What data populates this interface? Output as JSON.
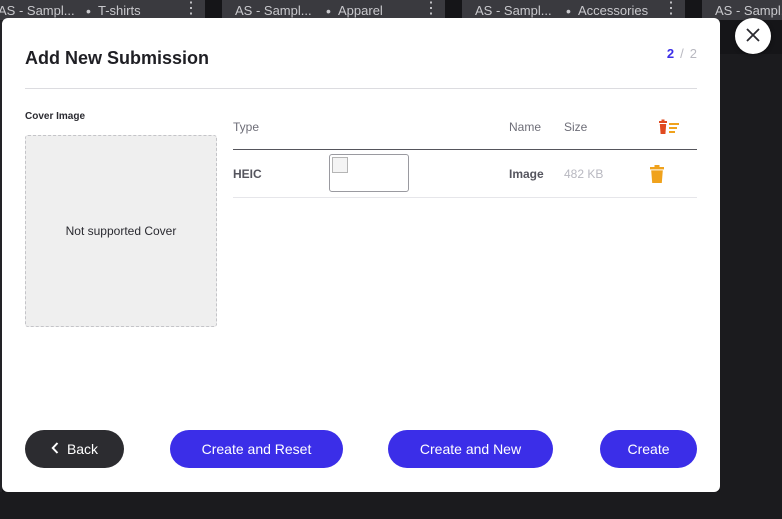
{
  "background_cards": [
    {
      "title": "AS - Sampl...",
      "category": "T-shirts"
    },
    {
      "title": "AS - Sampl...",
      "category": "Apparel"
    },
    {
      "title": "AS - Sampl...",
      "category": "Accessories"
    },
    {
      "title": "AS - Sampl...",
      "category": ""
    }
  ],
  "modal": {
    "title": "Add New Submission",
    "step_current": "2",
    "step_separator": "/",
    "step_total": "2"
  },
  "cover": {
    "label": "Cover Image",
    "placeholder_text": "Not supported Cover"
  },
  "table": {
    "headers": {
      "type": "Type",
      "name": "Name",
      "size": "Size"
    },
    "rows": [
      {
        "type": "HEIC",
        "name": "Image",
        "size": "482 KB"
      }
    ]
  },
  "buttons": {
    "back": "Back",
    "create_and_reset": "Create and Reset",
    "create_and_new": "Create and New",
    "create": "Create"
  },
  "colors": {
    "primary": "#3b2ee8",
    "delete_orange": "#f0a21c",
    "delete_all_red": "#e04a20"
  },
  "icons": {
    "close": "close-icon",
    "back": "chevron-left-icon",
    "delete_row": "trash-icon",
    "delete_all": "delete-all-icon"
  }
}
